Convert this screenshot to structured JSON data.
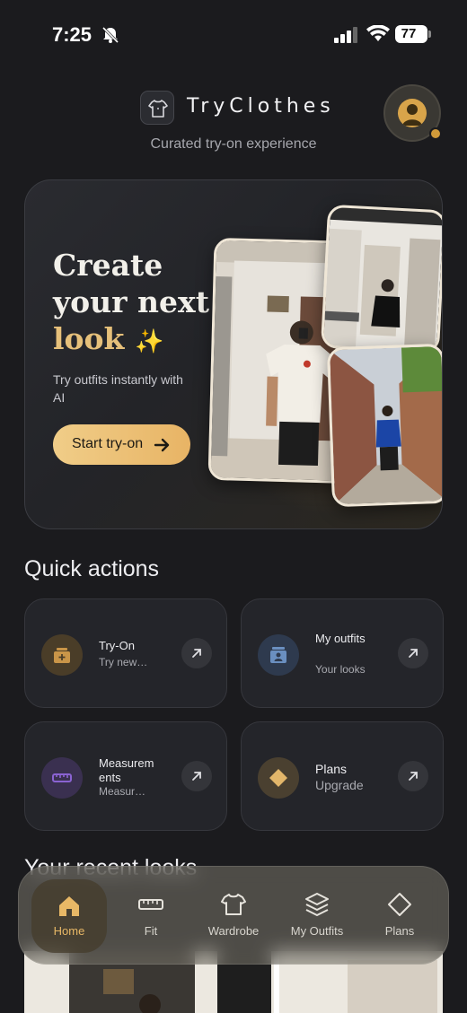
{
  "status_bar": {
    "time": "7:25",
    "battery": "77"
  },
  "header": {
    "app_name": "TryClothes",
    "tagline": "Curated try-on experience"
  },
  "hero": {
    "title_line1": "Create",
    "title_line2": "your next",
    "title_accent": "look",
    "title_emoji": "✨",
    "subtitle": "Try outfits instantly with AI",
    "cta_label": "Start try-on"
  },
  "quick_actions": {
    "title": "Quick actions",
    "items": [
      {
        "title": "Try-On",
        "subtitle": "Try new…",
        "icon": "tryon-icon",
        "color": "#c99548"
      },
      {
        "title": "My outfits",
        "subtitle": "Your looks",
        "icon": "outfits-icon",
        "color": "#6a8fc0"
      },
      {
        "title": "Measurem ents",
        "subtitle": "Measur…",
        "icon": "ruler-icon",
        "color": "#8a63d2"
      },
      {
        "title": "Plans",
        "subtitle": "Upgrade",
        "icon": "diamond-icon",
        "color": "#e2b66a"
      }
    ]
  },
  "recent": {
    "title": "Your recent looks"
  },
  "bottom_nav": {
    "items": [
      {
        "label": "Home",
        "icon": "home-icon",
        "active": true
      },
      {
        "label": "Fit",
        "icon": "ruler-icon",
        "active": false
      },
      {
        "label": "Wardrobe",
        "icon": "shirt-icon",
        "active": false
      },
      {
        "label": "My Outfits",
        "icon": "layers-icon",
        "active": false
      },
      {
        "label": "Plans",
        "icon": "diamond-icon",
        "active": false
      }
    ]
  },
  "colors": {
    "accent": "#e6c07a",
    "background": "#1b1b1e",
    "card": "#24252a"
  }
}
